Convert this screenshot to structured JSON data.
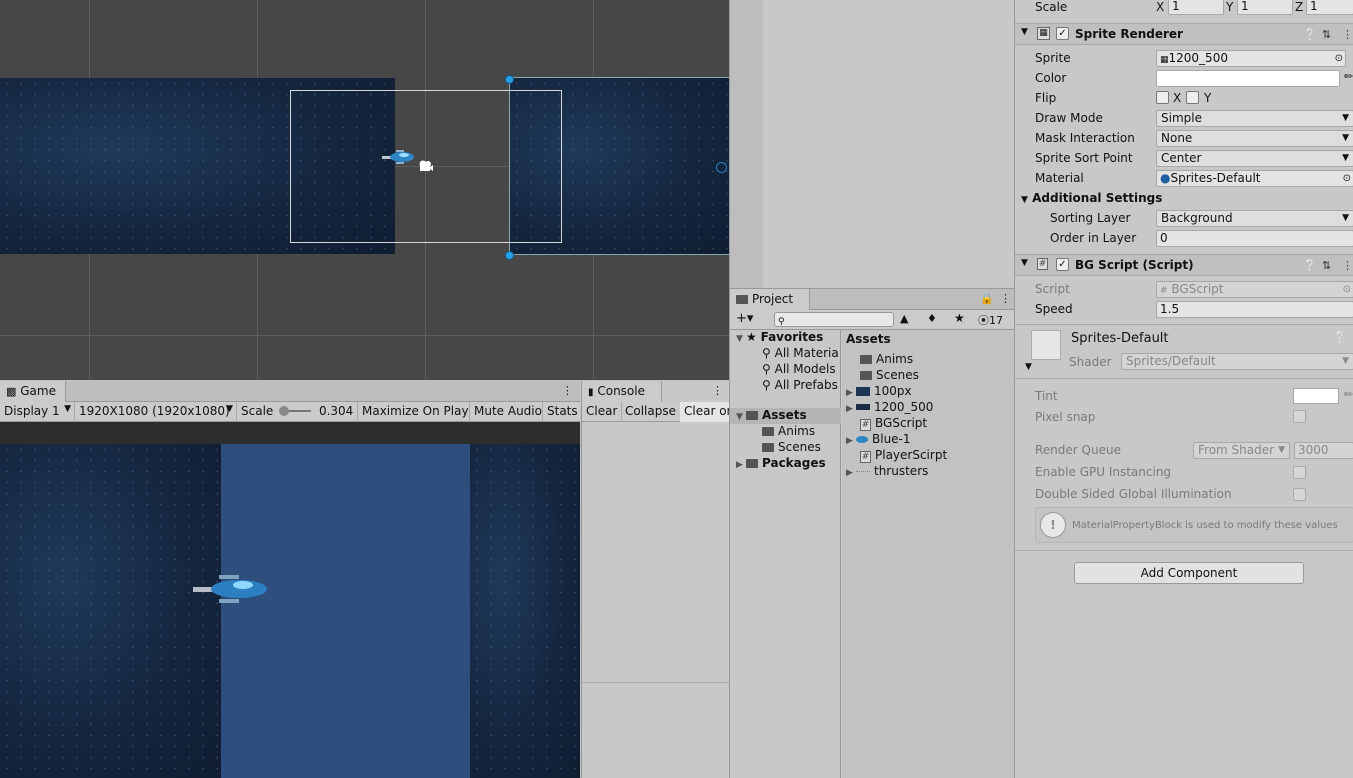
{
  "scene": {},
  "game": {
    "tab": "Game",
    "display": "Display 1",
    "resolution": "1920X1080 (1920x1080)",
    "scale_label": "Scale",
    "scale_value": "0.304",
    "maximize": "Maximize On Play",
    "mute": "Mute Audio",
    "stats": "Stats"
  },
  "console": {
    "tab": "Console",
    "clear": "Clear",
    "collapse": "Collapse",
    "clear_on": "Clear or"
  },
  "project": {
    "tab": "Project",
    "hidden_count": "17",
    "tree": {
      "favorites": "Favorites",
      "fav_items": [
        "All Materia",
        "All Models",
        "All Prefabs"
      ],
      "assets": "Assets",
      "asset_children": [
        "Anims",
        "Scenes"
      ],
      "packages": "Packages"
    },
    "assets_header": "Assets",
    "assets": [
      "Anims",
      "Scenes",
      "100px",
      "1200_500",
      "BGScript",
      "Blue-1",
      "PlayerScirpt",
      "thrusters"
    ]
  },
  "inspector": {
    "scale_label": "Scale",
    "scale": {
      "x_label": "X",
      "x": "1",
      "y_label": "Y",
      "y": "1",
      "z_label": "Z",
      "z": "1"
    },
    "sprite_renderer": {
      "title": "Sprite Renderer",
      "sprite_label": "Sprite",
      "sprite": "1200_500",
      "color_label": "Color",
      "flip_label": "Flip",
      "flip_x": "X",
      "flip_y": "Y",
      "draw_mode_label": "Draw Mode",
      "draw_mode": "Simple",
      "mask_label": "Mask Interaction",
      "mask": "None",
      "sort_point_label": "Sprite Sort Point",
      "sort_point": "Center",
      "material_label": "Material",
      "material": "Sprites-Default",
      "additional": "Additional Settings",
      "sorting_layer_label": "Sorting Layer",
      "sorting_layer": "Background",
      "order_label": "Order in Layer",
      "order": "0"
    },
    "bg_script": {
      "title": "BG Script (Script)",
      "script_label": "Script",
      "script": "BGScript",
      "speed_label": "Speed",
      "speed": "1.5"
    },
    "material": {
      "name": "Sprites-Default",
      "shader_label": "Shader",
      "shader": "Sprites/Default",
      "tint_label": "Tint",
      "pixel_snap_label": "Pixel snap",
      "render_queue_label": "Render Queue",
      "render_queue_mode": "From Shader",
      "render_queue": "3000",
      "gpu_label": "Enable GPU Instancing",
      "double_sided_label": "Double Sided Global Illumination",
      "info": "MaterialPropertyBlock is used to modify these values"
    },
    "add_component": "Add Component"
  }
}
